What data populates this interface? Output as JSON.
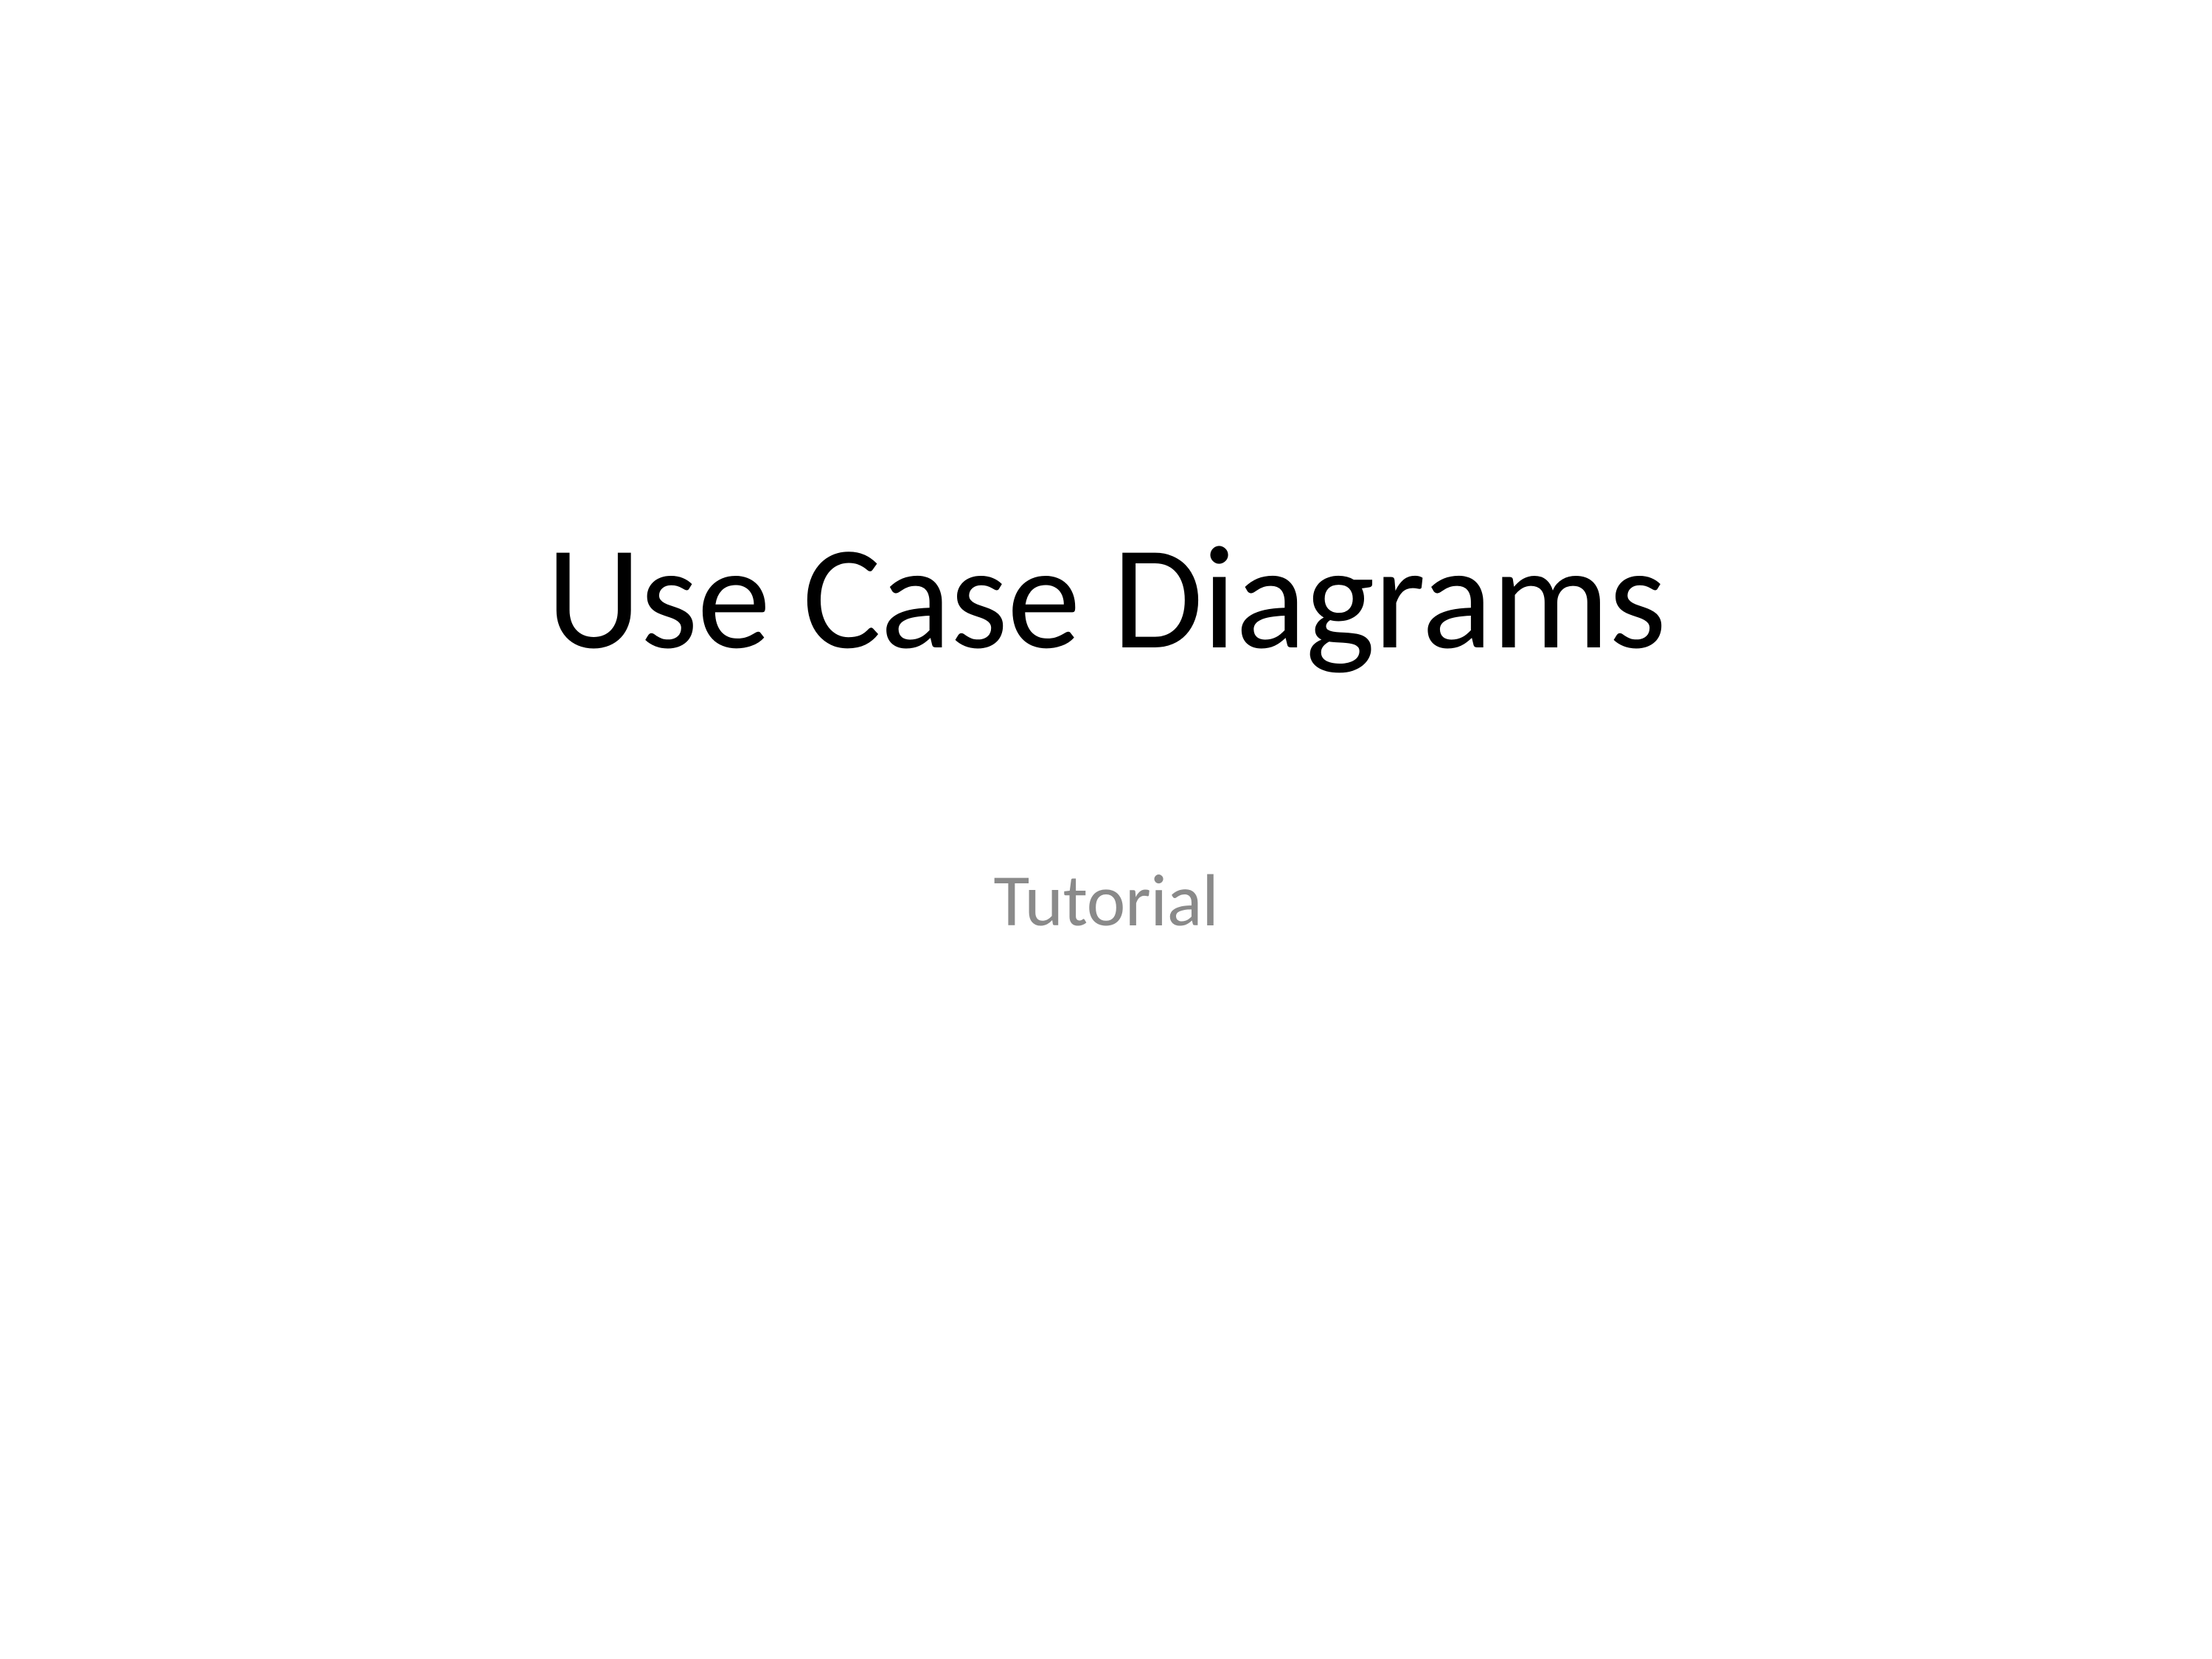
{
  "slide": {
    "title": "Use Case Diagrams",
    "subtitle": "Tutorial"
  }
}
